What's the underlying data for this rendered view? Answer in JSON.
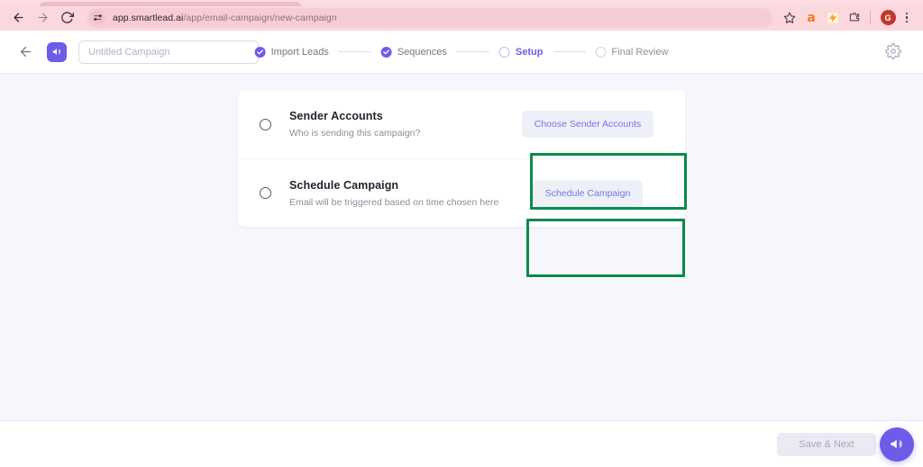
{
  "browser": {
    "back_icon": "back-arrow-icon",
    "forward_icon": "forward-arrow-icon",
    "reload_icon": "reload-icon",
    "site_settings_icon": "site-settings-sliders-icon",
    "url_domain": "app.smartlead.ai",
    "url_path": "/app/email-campaign/new-campaign",
    "bookmark_icon": "star-icon",
    "extensions": [
      {
        "name": "amazon-extension-icon",
        "glyph": "a"
      },
      {
        "name": "honey-extension-icon",
        "glyph": "⚡"
      },
      {
        "name": "extensions-puzzle-icon",
        "glyph": "⬚"
      }
    ],
    "profile_initial": "G",
    "menu_icon": "kebab-menu-icon"
  },
  "header": {
    "back_label": "back-arrow-icon",
    "logo_name": "smartlead-megaphone-logo",
    "campaign_name_value": "",
    "campaign_name_placeholder": "Untitled Campaign",
    "settings_icon": "gear-icon"
  },
  "stepper": {
    "steps": [
      {
        "label": "Import Leads",
        "state": "done"
      },
      {
        "label": "Sequences",
        "state": "done"
      },
      {
        "label": "Setup",
        "state": "active"
      },
      {
        "label": "Final Review",
        "state": "todo"
      }
    ]
  },
  "setup_rows": [
    {
      "title": "Sender Accounts",
      "subtitle": "Who is sending this campaign?",
      "action_label": "Choose Sender Accounts",
      "checked": false
    },
    {
      "title": "Schedule Campaign",
      "subtitle": "Email will be triggered based on time chosen here",
      "action_label": "Schedule Campaign",
      "checked": false
    }
  ],
  "footer": {
    "save_label": "Save & Next",
    "save_disabled": true,
    "fab_icon": "megaphone-icon"
  },
  "colors": {
    "accent": "#6c5ce7",
    "highlight": "#0c8a4d",
    "page_bg": "#f7f6fc",
    "ghost_btn_bg": "#eef0f8",
    "ghost_btn_text": "#7b71e8"
  }
}
